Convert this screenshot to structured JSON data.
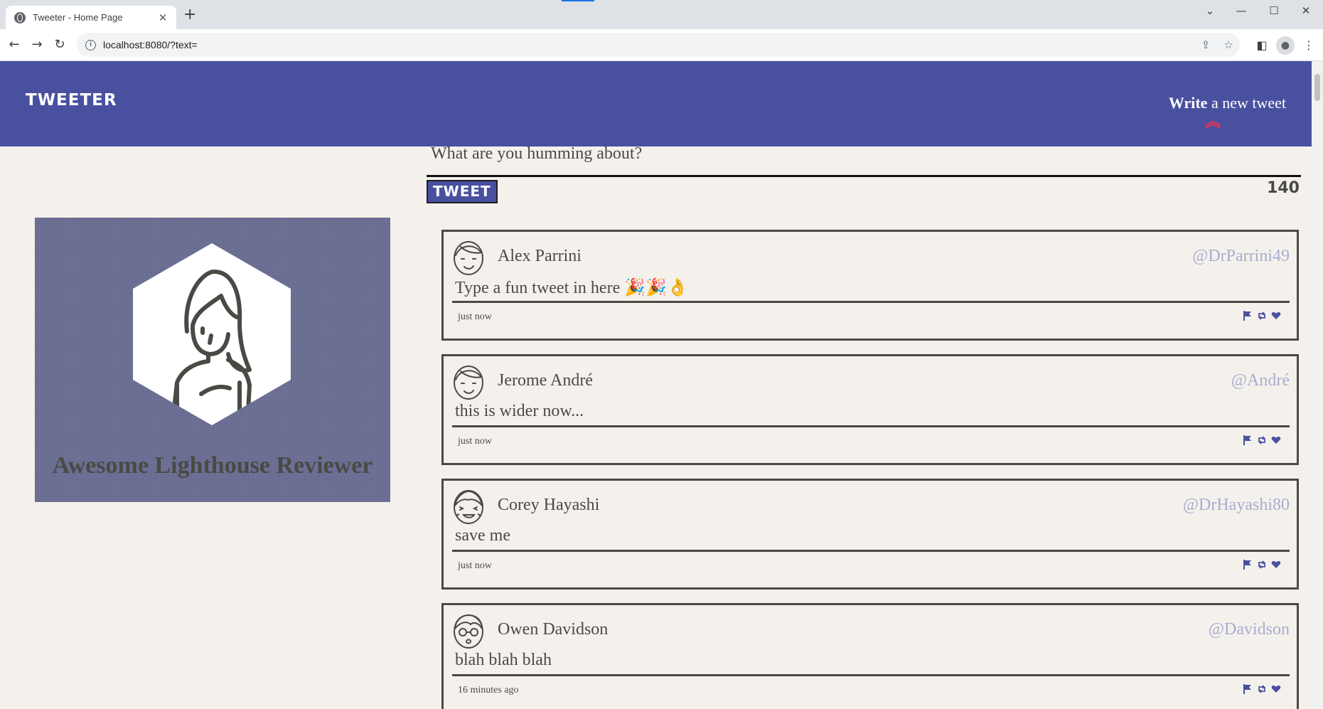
{
  "browser": {
    "tab_title": "Tweeter - Home Page",
    "tab_close": "✕",
    "new_tab": "+",
    "url": "localhost:8080/?text="
  },
  "nav": {
    "logo": "TWEETER",
    "write_bold": "Write",
    "write_rest": " a new tweet",
    "write_arrow": "︽"
  },
  "profile": {
    "name": "Awesome Lighthouse Reviewer"
  },
  "compose": {
    "placeholder": "What are you humming about?",
    "button": "TWEET",
    "counter": "140"
  },
  "tweets": [
    {
      "name": "Alex Parrini",
      "handle": "@DrParrini49",
      "text": "Type a fun tweet in here 🎉🎉👌",
      "time": "just now",
      "avatar": "avatar-smile-icon"
    },
    {
      "name": "Jerome André",
      "handle": "@André",
      "text": "this is wider now...",
      "time": "just now",
      "avatar": "avatar-smile-icon"
    },
    {
      "name": "Corey Hayashi",
      "handle": "@DrHayashi80",
      "text": "save me",
      "time": "just now",
      "avatar": "avatar-squint-icon"
    },
    {
      "name": "Owen Davidson",
      "handle": "@Davidson",
      "text": "blah blah blah",
      "time": "16 minutes ago",
      "avatar": "avatar-glasses-icon"
    }
  ],
  "colors": {
    "nav": "#4a50a0",
    "page": "#f4f1ec",
    "ink": "#4a4a44",
    "handle": "#a9acd0",
    "accent_arrow": "#e8324f"
  }
}
